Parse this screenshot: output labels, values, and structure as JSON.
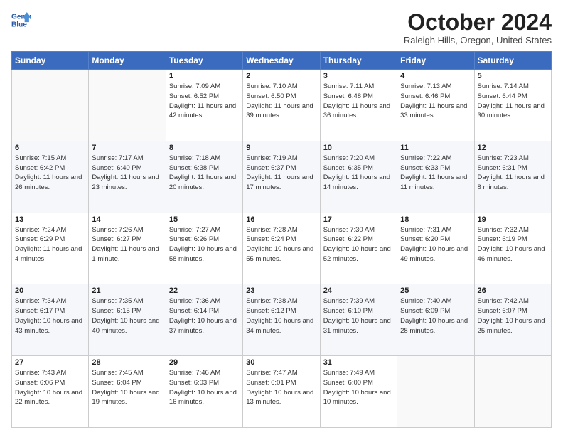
{
  "logo": {
    "line1": "General",
    "line2": "Blue"
  },
  "title": "October 2024",
  "subtitle": "Raleigh Hills, Oregon, United States",
  "days_of_week": [
    "Sunday",
    "Monday",
    "Tuesday",
    "Wednesday",
    "Thursday",
    "Friday",
    "Saturday"
  ],
  "weeks": [
    [
      {
        "day": "",
        "info": ""
      },
      {
        "day": "",
        "info": ""
      },
      {
        "day": "1",
        "info": "Sunrise: 7:09 AM\nSunset: 6:52 PM\nDaylight: 11 hours\nand 42 minutes."
      },
      {
        "day": "2",
        "info": "Sunrise: 7:10 AM\nSunset: 6:50 PM\nDaylight: 11 hours\nand 39 minutes."
      },
      {
        "day": "3",
        "info": "Sunrise: 7:11 AM\nSunset: 6:48 PM\nDaylight: 11 hours\nand 36 minutes."
      },
      {
        "day": "4",
        "info": "Sunrise: 7:13 AM\nSunset: 6:46 PM\nDaylight: 11 hours\nand 33 minutes."
      },
      {
        "day": "5",
        "info": "Sunrise: 7:14 AM\nSunset: 6:44 PM\nDaylight: 11 hours\nand 30 minutes."
      }
    ],
    [
      {
        "day": "6",
        "info": "Sunrise: 7:15 AM\nSunset: 6:42 PM\nDaylight: 11 hours\nand 26 minutes."
      },
      {
        "day": "7",
        "info": "Sunrise: 7:17 AM\nSunset: 6:40 PM\nDaylight: 11 hours\nand 23 minutes."
      },
      {
        "day": "8",
        "info": "Sunrise: 7:18 AM\nSunset: 6:38 PM\nDaylight: 11 hours\nand 20 minutes."
      },
      {
        "day": "9",
        "info": "Sunrise: 7:19 AM\nSunset: 6:37 PM\nDaylight: 11 hours\nand 17 minutes."
      },
      {
        "day": "10",
        "info": "Sunrise: 7:20 AM\nSunset: 6:35 PM\nDaylight: 11 hours\nand 14 minutes."
      },
      {
        "day": "11",
        "info": "Sunrise: 7:22 AM\nSunset: 6:33 PM\nDaylight: 11 hours\nand 11 minutes."
      },
      {
        "day": "12",
        "info": "Sunrise: 7:23 AM\nSunset: 6:31 PM\nDaylight: 11 hours\nand 8 minutes."
      }
    ],
    [
      {
        "day": "13",
        "info": "Sunrise: 7:24 AM\nSunset: 6:29 PM\nDaylight: 11 hours\nand 4 minutes."
      },
      {
        "day": "14",
        "info": "Sunrise: 7:26 AM\nSunset: 6:27 PM\nDaylight: 11 hours\nand 1 minute."
      },
      {
        "day": "15",
        "info": "Sunrise: 7:27 AM\nSunset: 6:26 PM\nDaylight: 10 hours\nand 58 minutes."
      },
      {
        "day": "16",
        "info": "Sunrise: 7:28 AM\nSunset: 6:24 PM\nDaylight: 10 hours\nand 55 minutes."
      },
      {
        "day": "17",
        "info": "Sunrise: 7:30 AM\nSunset: 6:22 PM\nDaylight: 10 hours\nand 52 minutes."
      },
      {
        "day": "18",
        "info": "Sunrise: 7:31 AM\nSunset: 6:20 PM\nDaylight: 10 hours\nand 49 minutes."
      },
      {
        "day": "19",
        "info": "Sunrise: 7:32 AM\nSunset: 6:19 PM\nDaylight: 10 hours\nand 46 minutes."
      }
    ],
    [
      {
        "day": "20",
        "info": "Sunrise: 7:34 AM\nSunset: 6:17 PM\nDaylight: 10 hours\nand 43 minutes."
      },
      {
        "day": "21",
        "info": "Sunrise: 7:35 AM\nSunset: 6:15 PM\nDaylight: 10 hours\nand 40 minutes."
      },
      {
        "day": "22",
        "info": "Sunrise: 7:36 AM\nSunset: 6:14 PM\nDaylight: 10 hours\nand 37 minutes."
      },
      {
        "day": "23",
        "info": "Sunrise: 7:38 AM\nSunset: 6:12 PM\nDaylight: 10 hours\nand 34 minutes."
      },
      {
        "day": "24",
        "info": "Sunrise: 7:39 AM\nSunset: 6:10 PM\nDaylight: 10 hours\nand 31 minutes."
      },
      {
        "day": "25",
        "info": "Sunrise: 7:40 AM\nSunset: 6:09 PM\nDaylight: 10 hours\nand 28 minutes."
      },
      {
        "day": "26",
        "info": "Sunrise: 7:42 AM\nSunset: 6:07 PM\nDaylight: 10 hours\nand 25 minutes."
      }
    ],
    [
      {
        "day": "27",
        "info": "Sunrise: 7:43 AM\nSunset: 6:06 PM\nDaylight: 10 hours\nand 22 minutes."
      },
      {
        "day": "28",
        "info": "Sunrise: 7:45 AM\nSunset: 6:04 PM\nDaylight: 10 hours\nand 19 minutes."
      },
      {
        "day": "29",
        "info": "Sunrise: 7:46 AM\nSunset: 6:03 PM\nDaylight: 10 hours\nand 16 minutes."
      },
      {
        "day": "30",
        "info": "Sunrise: 7:47 AM\nSunset: 6:01 PM\nDaylight: 10 hours\nand 13 minutes."
      },
      {
        "day": "31",
        "info": "Sunrise: 7:49 AM\nSunset: 6:00 PM\nDaylight: 10 hours\nand 10 minutes."
      },
      {
        "day": "",
        "info": ""
      },
      {
        "day": "",
        "info": ""
      }
    ]
  ]
}
